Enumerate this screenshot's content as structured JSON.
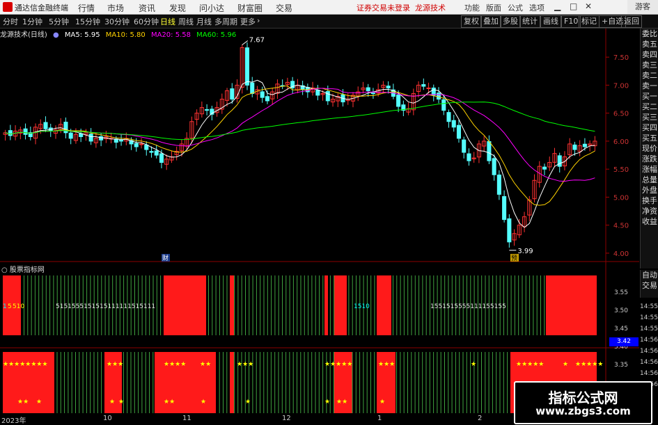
{
  "app": {
    "title": "通达信金融终端"
  },
  "menu": [
    "行情",
    "市场",
    "资讯",
    "发现",
    "问小达",
    "财富圈",
    "交易"
  ],
  "header_links": [
    "证券交易未登录",
    "龙源技术"
  ],
  "right_menu": [
    "功能",
    "版面",
    "公式",
    "选项"
  ],
  "guest": "游客",
  "tabs": [
    "分时",
    "1分钟",
    "5分钟",
    "15分钟",
    "30分钟",
    "60分钟",
    "日线",
    "周线",
    "月线",
    "多周期",
    "更多"
  ],
  "active_tab": "日线",
  "tools": [
    "复权",
    "叠加",
    "多股",
    "统计",
    "画线",
    "F10",
    "标记",
    "+自选",
    "返回"
  ],
  "legend": {
    "name": "龙源技术(日线)",
    "ma5": "MA5: 5.95",
    "ma10": "MA10: 5.80",
    "ma20": "MA20: 5.58",
    "ma60": "MA60: 5.96"
  },
  "colors": {
    "up": "#ff3232",
    "down": "#54ffff",
    "ma5": "#ffffff",
    "ma10": "#ffd200",
    "ma20": "#ff00ff",
    "ma60": "#00ff00"
  },
  "price_axis": [
    "7.50",
    "7.00",
    "6.50",
    "6.00",
    "5.50",
    "5.00",
    "4.50",
    "4.00"
  ],
  "annotations": {
    "high": "7.67",
    "low": "3.99",
    "marker1": "财",
    "marker2": "预"
  },
  "right_panel": [
    "委比",
    "卖五",
    "卖四",
    "卖三",
    "卖二",
    "卖一",
    "买一",
    "买二",
    "买三",
    "买四",
    "买五",
    "现价",
    "涨跌",
    "涨幅",
    "总量",
    "外盘",
    "换手",
    "净资",
    "收益"
  ],
  "right_panel2": [
    "自动",
    "交易"
  ],
  "indicator": {
    "title": "股票指标网",
    "axis": [
      "3.55",
      "3.50",
      "3.45",
      "3.40",
      "3.35"
    ],
    "times": [
      "14:55",
      "14:55",
      "14:55",
      "14:55",
      "14:56",
      "14:56",
      "14:56",
      "14:56",
      "14:56"
    ],
    "price_badge": "3.42",
    "digits1": [
      "1",
      "5",
      "1",
      "5",
      "1",
      "1",
      "0"
    ],
    "digits2": "5151555151515111111515111",
    "digits3": "1510",
    "digits4": "1551515555111155155",
    "stars": "★"
  },
  "dates": [
    "2023年",
    "10",
    "11",
    "12",
    "1",
    "2"
  ],
  "watermark": {
    "title": "指标公式网",
    "url": "www.zbgs3.com"
  },
  "chart_data": {
    "type": "candlestick",
    "title": "龙源技术(日线)",
    "ylim": [
      3.9,
      7.8
    ],
    "x_labels": [
      "2023年",
      "10",
      "11",
      "12",
      "1",
      "2"
    ],
    "close": [
      6.15,
      6.1,
      6.18,
      6.2,
      6.12,
      6.08,
      6.25,
      6.3,
      6.22,
      6.18,
      6.2,
      6.3,
      6.15,
      6.05,
      6.12,
      6.08,
      6.15,
      6.0,
      6.05,
      6.02,
      6.08,
      6.05,
      5.98,
      6.0,
      6.05,
      5.95,
      5.9,
      5.95,
      5.85,
      5.8,
      5.75,
      5.62,
      5.68,
      5.72,
      5.82,
      5.95,
      6.05,
      6.35,
      6.5,
      6.6,
      6.55,
      6.48,
      6.6,
      6.75,
      6.9,
      6.75,
      7.0,
      7.67,
      7.0,
      6.85,
      6.92,
      6.78,
      6.72,
      6.88,
      7.02,
      6.98,
      7.05,
      6.95,
      7.0,
      6.92,
      6.88,
      6.95,
      6.82,
      6.85,
      6.72,
      6.75,
      6.8,
      6.7,
      6.75,
      6.82,
      6.88,
      6.95,
      6.9,
      6.85,
      6.92,
      7.0,
      6.95,
      6.8,
      6.62,
      6.55,
      6.58,
      6.85,
      7.0,
      6.98,
      6.95,
      6.82,
      6.75,
      6.55,
      6.35,
      6.25,
      6.05,
      5.8,
      5.65,
      5.7,
      5.95,
      6.0,
      5.65,
      5.4,
      5.05,
      4.6,
      4.2,
      4.35,
      4.5,
      4.65,
      4.95,
      5.3,
      5.55,
      5.5,
      5.62,
      5.78,
      5.55,
      5.72,
      5.95,
      5.85,
      5.92,
      5.9,
      5.95,
      6.0
    ],
    "candles_count": 108
  }
}
